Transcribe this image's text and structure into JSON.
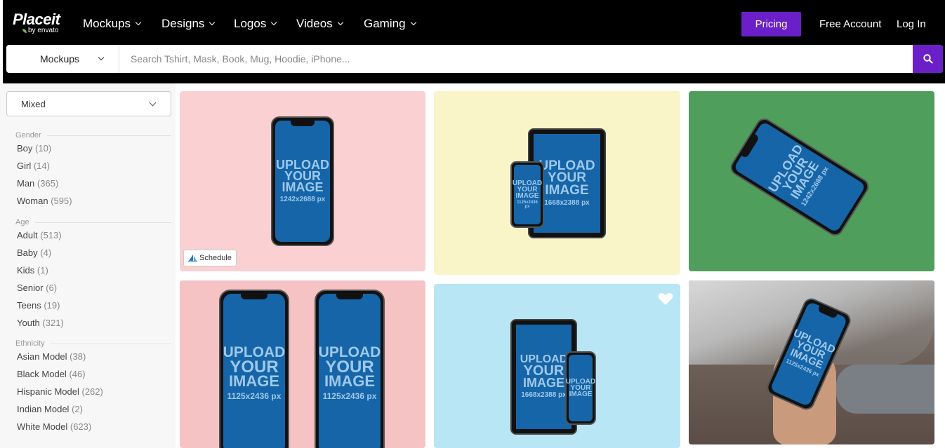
{
  "brand": {
    "name": "Placeit",
    "sub": "by envato"
  },
  "nav": [
    {
      "label": "Mockups"
    },
    {
      "label": "Designs"
    },
    {
      "label": "Logos"
    },
    {
      "label": "Videos"
    },
    {
      "label": "Gaming"
    }
  ],
  "header": {
    "pricing": "Pricing",
    "free_account": "Free Account",
    "login": "Log In"
  },
  "search": {
    "category": "Mockups",
    "placeholder": "Search Tshirt, Mask, Book, Mug, Hoodie, iPhone...",
    "button_icon": "search-icon"
  },
  "sort": {
    "value": "Mixed"
  },
  "filters": {
    "gender": {
      "title": "Gender",
      "items": [
        {
          "label": "Boy",
          "count": "(10)"
        },
        {
          "label": "Girl",
          "count": "(14)"
        },
        {
          "label": "Man",
          "count": "(365)"
        },
        {
          "label": "Woman",
          "count": "(595)"
        }
      ]
    },
    "age": {
      "title": "Age",
      "items": [
        {
          "label": "Adult",
          "count": "(513)"
        },
        {
          "label": "Baby",
          "count": "(4)"
        },
        {
          "label": "Kids",
          "count": "(1)"
        },
        {
          "label": "Senior",
          "count": "(6)"
        },
        {
          "label": "Teens",
          "count": "(19)"
        },
        {
          "label": "Youth",
          "count": "(321)"
        }
      ]
    },
    "ethnicity": {
      "title": "Ethnicity",
      "items": [
        {
          "label": "Asian Model",
          "count": "(38)"
        },
        {
          "label": "Black Model",
          "count": "(46)"
        },
        {
          "label": "Hispanic Model",
          "count": "(262)"
        },
        {
          "label": "Indian Model",
          "count": "(2)"
        },
        {
          "label": "White Model",
          "count": "(623)"
        }
      ]
    }
  },
  "cards": {
    "c1": {
      "bg": "#fbd0d3",
      "upload": [
        "UPLOAD",
        "YOUR",
        "IMAGE"
      ],
      "res": "1242x2688 px",
      "badge": "Schedule"
    },
    "c2": {
      "bg": "#faf5c8",
      "upload": [
        "UPLOAD",
        "YOUR",
        "IMAGE"
      ],
      "res_tablet": "1668x2388 px",
      "res_phone": "1125x2436 px"
    },
    "c3": {
      "bg": "#4f9e5c",
      "upload": [
        "UPLOAD",
        "YOUR",
        "IMAGE"
      ],
      "res": "1242x2688 px"
    },
    "c4": {
      "bg": "#f6c3c5",
      "upload": [
        "UPLOAD",
        "YOUR",
        "IMAGE"
      ],
      "res": "1125x2436 px"
    },
    "c5": {
      "bg": "#b9e6f4",
      "upload": [
        "UPLOAD",
        "YOUR",
        "IMAGE"
      ],
      "res_tablet": "1668x2388 px"
    },
    "c6": {
      "bg": "#5b4d46",
      "upload": [
        "UPLOAD",
        "YOUR",
        "IMAGE"
      ],
      "res": "1125x2436 px"
    }
  },
  "colors": {
    "accent": "#6b1fc8"
  }
}
